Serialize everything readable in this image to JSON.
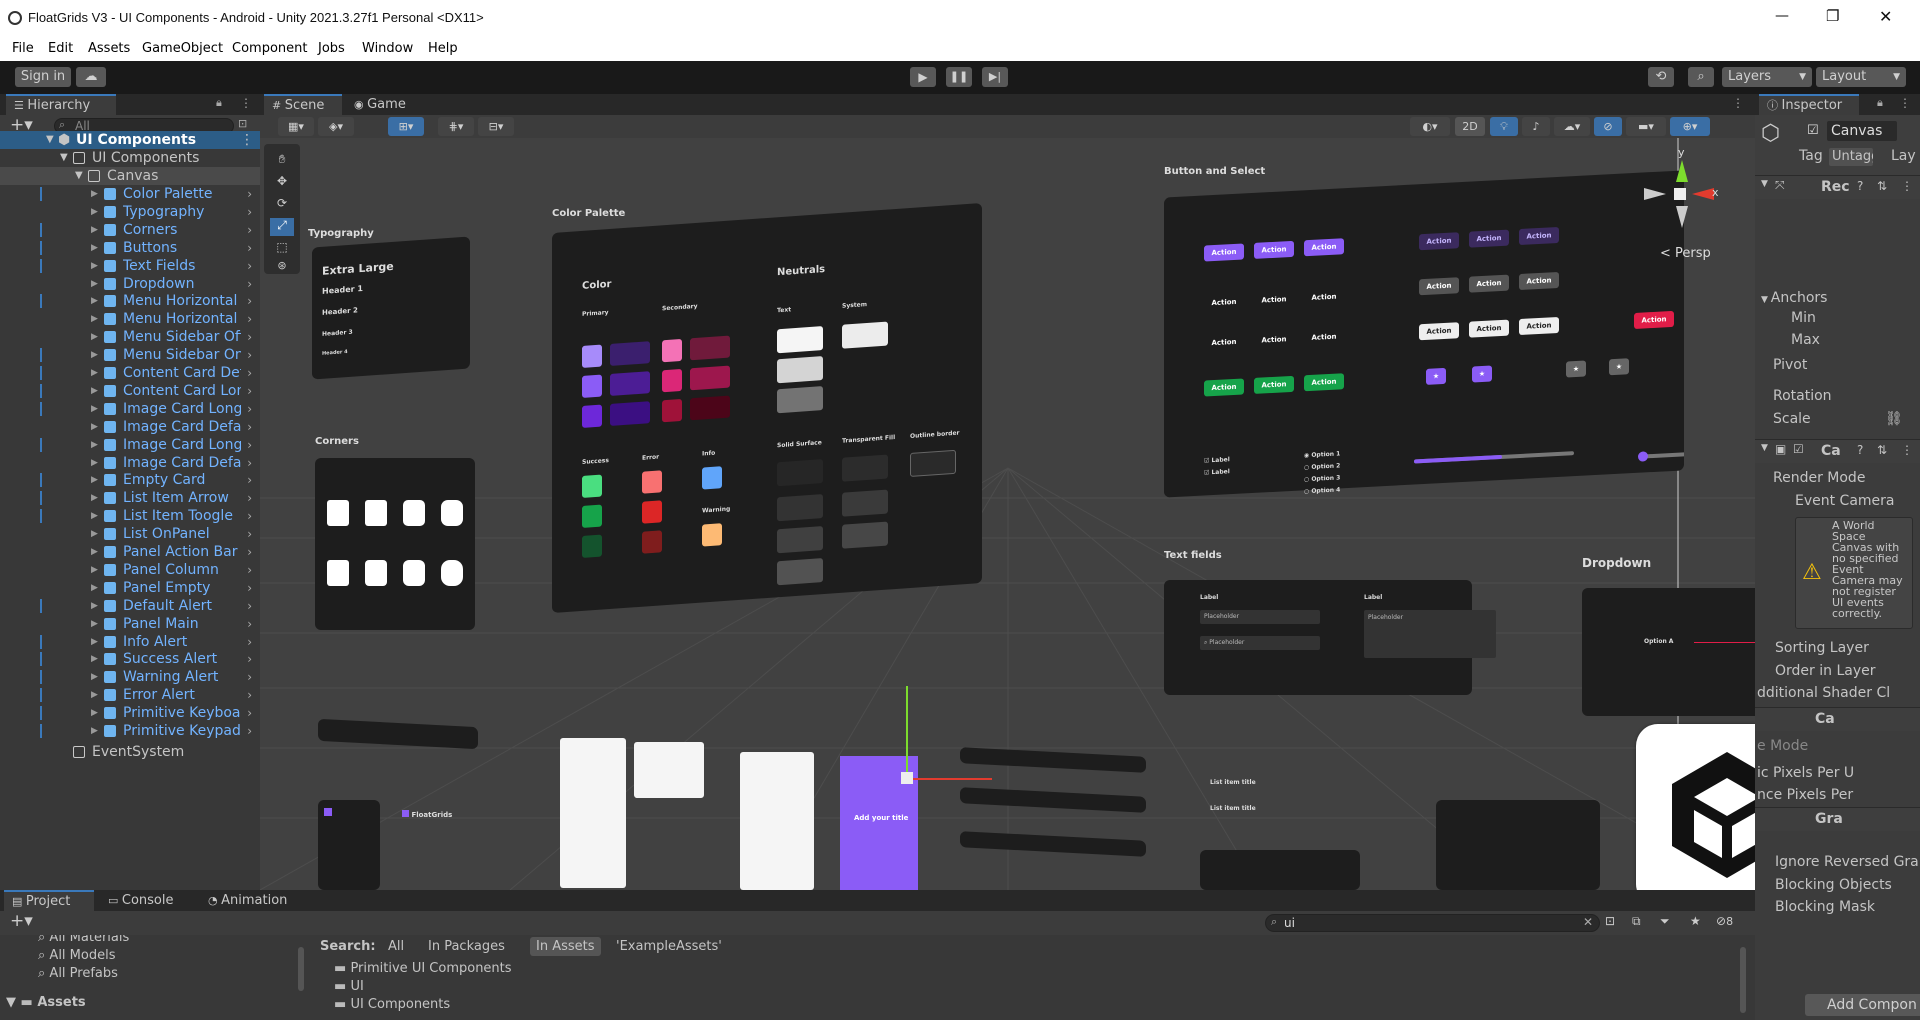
{
  "window": {
    "title": "FloatGrids V3 - UI Components - Android - Unity 2021.3.27f1 Personal <DX11>",
    "minimize": "—",
    "maximize": "❐",
    "close": "✕"
  },
  "menu": [
    "File",
    "Edit",
    "Assets",
    "GameObject",
    "Component",
    "Jobs",
    "Window",
    "Help"
  ],
  "toolbar": {
    "sign_in": "Sign in",
    "layers": "Layers",
    "layout": "Layout"
  },
  "hierarchy": {
    "tab": "Hierarchy",
    "search_placeholder": "All",
    "root": "UI Components",
    "child": "UI Components",
    "canvas": "Canvas",
    "items": [
      "Color Palette",
      "Typography",
      "Corners",
      "Buttons",
      "Text Fields",
      "Dropdown",
      "Menu Horizontal (",
      "Menu Horizontal (",
      "Menu Sidebar Off",
      "Menu Sidebar On",
      "Content Card Def",
      "Content Card Lon",
      "Image Card Long",
      "Image Card Defau",
      "Image Card Long",
      "Image Card Defau",
      "Empty Card",
      "List Item Arrow",
      "List Item Toogle",
      "List OnPanel",
      "Panel Action Bar",
      "Panel Column",
      "Panel Empty",
      "Default Alert",
      "Panel Main",
      "Info Alert",
      "Success Alert",
      "Warning Alert",
      "Error Alert",
      "Primitive Keyboar",
      "Primitive Keypad"
    ],
    "event_system": "EventSystem"
  },
  "scene": {
    "tab_scene": "Scene",
    "tab_game": "Game",
    "toggle_2d": "2D",
    "persp": "< Persp",
    "gizmo_x": "x",
    "gizmo_y": "y",
    "panels": {
      "typography": "Typography",
      "typo_lines": [
        "Extra Large",
        "Header 1",
        "Header 2",
        "Header 3",
        "Header 4"
      ],
      "corners": "Corners",
      "color_palette": "Color Palette",
      "color": "Color",
      "primary": "Primary",
      "secondary": "Secondary",
      "neutrals": "Neutrals",
      "text": "Text",
      "system": "System",
      "success": "Success",
      "error": "Error",
      "info": "Info",
      "warning": "Warning",
      "solid_surface": "Solid Surface",
      "transparent_fill": "Transparent Fill",
      "outline_border": "Outline border",
      "button_select": "Button and Select",
      "action": "Action",
      "label": "Label",
      "options": [
        "Option 1",
        "Option 2",
        "Option 3",
        "Option 4"
      ],
      "text_fields": "Text fields",
      "placeholder": "Placeholder",
      "dropdown": "Dropdown",
      "option_a": "Option A",
      "add_title": "Add your title",
      "floatgrids": "FloatGrids",
      "list_item_title": "List item title"
    }
  },
  "inspector": {
    "tab": "Inspector",
    "object_name": "Canvas",
    "tag_label": "Tag",
    "tag_value": "Untagged",
    "layer_label": "Lay",
    "rect_component": "Rec",
    "anchors": "Anchors",
    "min": "Min",
    "max": "Max",
    "pivot": "Pivot",
    "rotation": "Rotation",
    "scale": "Scale",
    "canvas_component": "Ca",
    "render_mode": "Render Mode",
    "event_camera": "Event Camera",
    "warning_text": "A World Space Canvas with no specified Event Camera may not register UI events correctly.",
    "sorting_layer": "Sorting Layer",
    "order_in_layer": "Order in Layer",
    "additional_shader": "dditional Shader Cl",
    "canvas_scaler": "Ca",
    "ui_scale_mode": "e Mode",
    "dynamic_pixels": "ic Pixels Per U",
    "reference_pixels": "nce Pixels Per",
    "graphic_raycaster": "Gra",
    "ignore_reversed": "Ignore Reversed Gra",
    "blocking_objects": "Blocking Objects",
    "blocking_mask": "Blocking Mask",
    "add_component": "Add Compon"
  },
  "project": {
    "tab_project": "Project",
    "tab_console": "Console",
    "tab_animation": "Animation",
    "favorites": [
      "All Materials",
      "All Models",
      "All Prefabs"
    ],
    "assets": "Assets",
    "search_value": "ui",
    "search_label": "Search:",
    "filters": [
      "All",
      "In Packages",
      "In Assets",
      "'ExampleAssets'"
    ],
    "results": [
      "Primitive UI Components",
      "UI",
      "UI Components"
    ],
    "count": "8"
  },
  "colors": {
    "accent_blue": "#3a79bb",
    "link_blue": "#72b3ff",
    "purple": "#8b5cf6",
    "green": "#22c55e",
    "red": "#e11d48"
  }
}
